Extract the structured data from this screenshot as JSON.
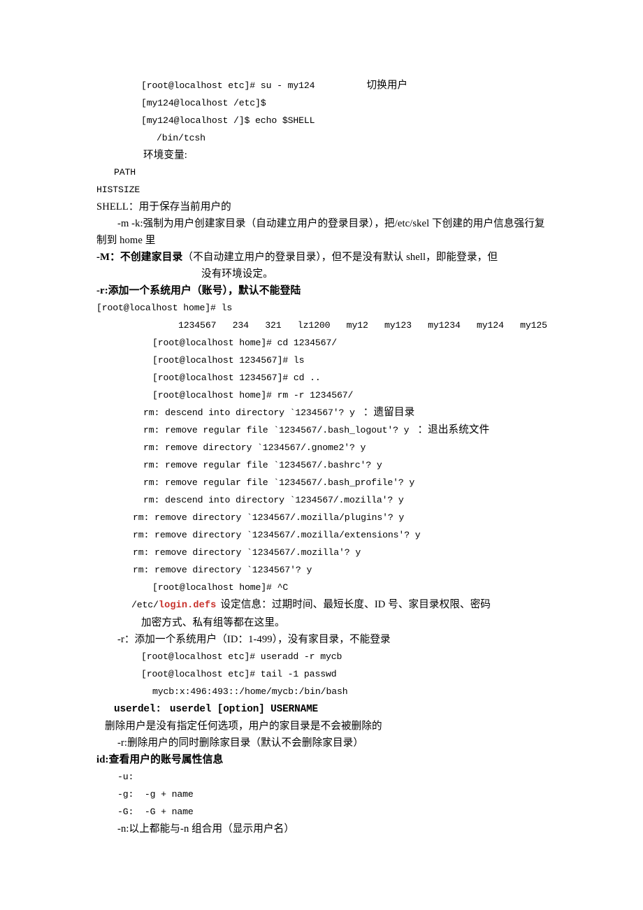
{
  "document": {
    "type": "scanned-notes",
    "language": "zh-CN + shell transcript",
    "page_background": "#ffffff",
    "accent_red": "#C8302A"
  },
  "lines": {
    "l1_prompt": "[root@localhost etc]# su - my124",
    "l1_note": "切换用户",
    "l2_prompt": "[my124@localhost /etc]$",
    "l3_prompt": "[my124@localhost /]$ echo $SHELL",
    "l4_output": "/bin/tcsh",
    "l5_heading": "环境变量:",
    "l6_var": "PATH",
    "l7_var": "HISTSIZE",
    "l8_var": "SHELL：用于保存当前用户的",
    "l9_opt_mk": "-m -k:强制为用户创建家目录（自动建立用户的登录目录），把/etc/skel 下创建的用户信息强行复制到 home 里",
    "l10_opt_M_flag": "-M：",
    "l10_opt_M_bold": "不创建家目录",
    "l10_opt_M_rest": "（不自动建立用户的登录目录），但不是没有默认 shell，即能登录，但",
    "l10_opt_M_cont": "没有环境设定。",
    "l11_opt_r": "-r:添加一个系统用户（账号），默认不能登陆",
    "l12_prompt": "[root@localhost home]# ls",
    "l13_listing": "1234567   234   321   lz1200   my12   my123   my1234   my124   my125",
    "l14_prompt": "[root@localhost home]# cd 1234567/",
    "l15_prompt": "[root@localhost 1234567]# ls",
    "l16_prompt": "[root@localhost 1234567]# cd ..",
    "l17_prompt": "[root@localhost home]# rm -r 1234567/",
    "l18_rm": "rm: descend into directory `1234567'? y",
    "l18_note": "：遗留目录",
    "l19_rm": "rm: remove regular file `1234567/.bash_logout'? y",
    "l19_note": "：退出系统文件",
    "l20_rm": "rm: remove directory `1234567/.gnome2'? y",
    "l21_rm": "rm: remove regular file `1234567/.bashrc'? y",
    "l22_rm": "rm: remove regular file `1234567/.bash_profile'? y",
    "l23_rm": "rm: descend into directory `1234567/.mozilla'? y",
    "l24_rm": "rm: remove directory `1234567/.mozilla/plugins'? y",
    "l25_rm": "rm: remove directory `1234567/.mozilla/extensions'? y",
    "l26_rm": "rm: remove directory `1234567/.mozilla'? y",
    "l27_rm": "rm: remove directory `1234567'? y",
    "l28_prompt": "[root@localhost home]# ^C",
    "l29_path_prefix": "/etc/",
    "l29_path_red": "login.defs",
    "l29_desc": "设定信息：过期时间、最短长度、ID 号、家目录权限、密码",
    "l29_desc_cont": "加密方式、私有组等都在这里。",
    "l30_opt_r": "-r：添加一个系统用户（ID：1-499），没有家目录，不能登录",
    "l31_prompt": "[root@localhost etc]# useradd -r mycb",
    "l32_prompt": "[root@localhost etc]# tail -1 passwd",
    "l33_output": "mycb:x:496:493::/home/mycb:/bin/bash",
    "l34_userdel_cmd": "userdel:",
    "l34_userdel_syntax": "userdel [option] USERNAME",
    "l35_desc": "删除用户是没有指定任何选项，用户的家目录是不会被删除的",
    "l36_opt_r": "-r:删除用户的同时删除家目录（默认不会删除家目录）",
    "l37_id_heading": "id:查看用户的账号属性信息",
    "l38_opt_u": "-u:",
    "l39_opt_g": "-g:  -g + name",
    "l40_opt_G": "-G:  -G + name",
    "l41_opt_n": "-n:以上都能与-n 组合用（显示用户名）"
  }
}
